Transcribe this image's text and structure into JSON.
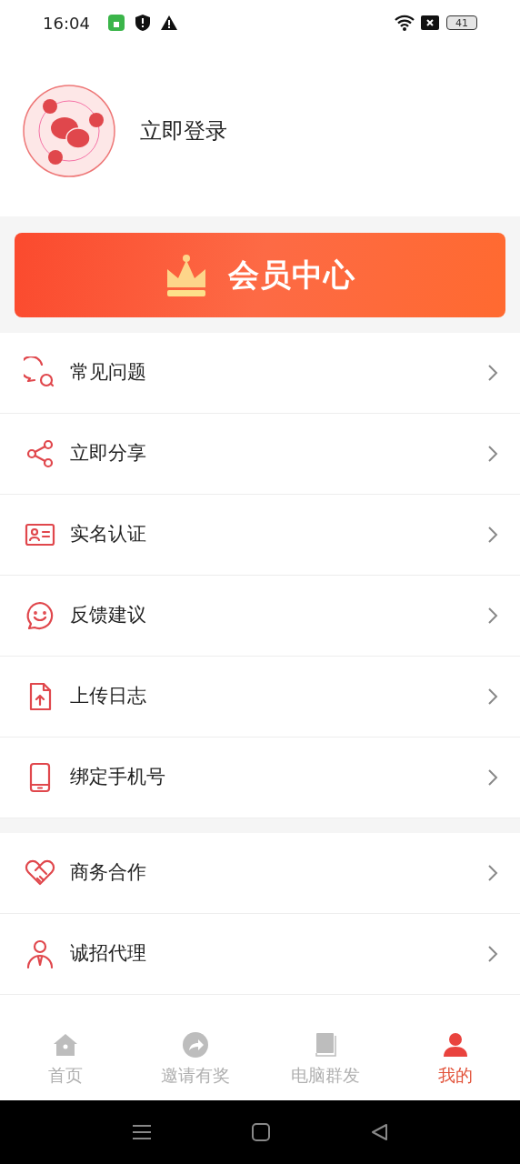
{
  "status_bar": {
    "time": "16:04",
    "battery": "41"
  },
  "profile": {
    "login_label": "立即登录"
  },
  "vip_banner": {
    "label": "会员中心"
  },
  "menu_groups": [
    {
      "items": [
        {
          "kind": "faq",
          "label": "常见问题"
        },
        {
          "kind": "share",
          "label": "立即分享"
        },
        {
          "kind": "idcard",
          "label": "实名认证"
        },
        {
          "kind": "feedback",
          "label": "反馈建议"
        },
        {
          "kind": "upload",
          "label": "上传日志"
        },
        {
          "kind": "phone",
          "label": "绑定手机号"
        }
      ]
    },
    {
      "items": [
        {
          "kind": "handshake",
          "label": "商务合作"
        },
        {
          "kind": "agent",
          "label": "诚招代理"
        }
      ]
    }
  ],
  "tab_bar": [
    {
      "kind": "home",
      "label": "首页",
      "selected": false
    },
    {
      "kind": "invite",
      "label": "邀请有奖",
      "selected": false
    },
    {
      "kind": "book",
      "label": "电脑群发",
      "selected": false
    },
    {
      "kind": "user",
      "label": "我的",
      "selected": true
    }
  ]
}
